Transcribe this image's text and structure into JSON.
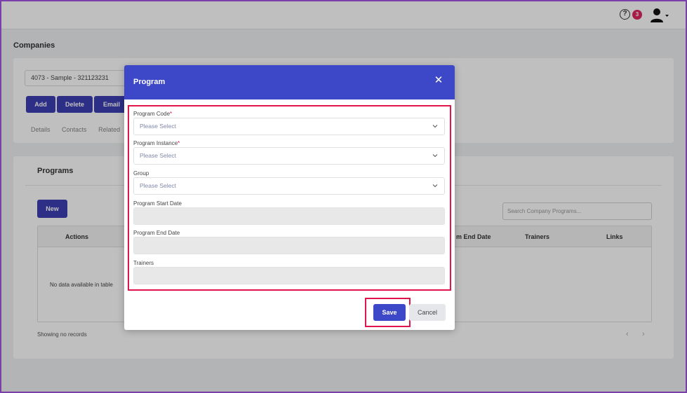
{
  "header": {
    "help_glyph": "?",
    "notification_count": "3",
    "icons": [
      "help-icon",
      "user-icon",
      "caret-down-icon"
    ]
  },
  "page": {
    "title": "Companies",
    "company_selector_value": "4073 - Sample - 321123231",
    "actions": [
      "Add",
      "Delete",
      "Email"
    ],
    "tabs": [
      "Details",
      "Contacts",
      "Related"
    ]
  },
  "programs_section": {
    "title": "Programs",
    "new_label": "New",
    "search_placeholder": "Search Company Programs...",
    "columns": [
      "Actions",
      "m End Date",
      "Trainers",
      "Links"
    ],
    "empty_message": "No data available in table",
    "showing": "Showing no records",
    "pager_prev": "‹",
    "pager_next": "›"
  },
  "modal": {
    "title": "Program",
    "close_glyph": "✕",
    "fields": {
      "program_code": {
        "label": "Program Code",
        "required_mark": "*",
        "placeholder": "Please Select"
      },
      "program_instance": {
        "label": "Program Instance",
        "required_mark": "*",
        "placeholder": "Please Select"
      },
      "group": {
        "label": "Group",
        "placeholder": "Please Select"
      },
      "start_date": {
        "label": "Program Start Date",
        "value": ""
      },
      "end_date": {
        "label": "Program End Date",
        "value": ""
      },
      "trainers": {
        "label": "Trainers",
        "value": ""
      }
    },
    "save_label": "Save",
    "cancel_label": "Cancel"
  },
  "colors": {
    "primary": "#3d48c8",
    "highlight": "#e0164a",
    "badge": "#e0245e",
    "frame": "#7a3fa8"
  }
}
